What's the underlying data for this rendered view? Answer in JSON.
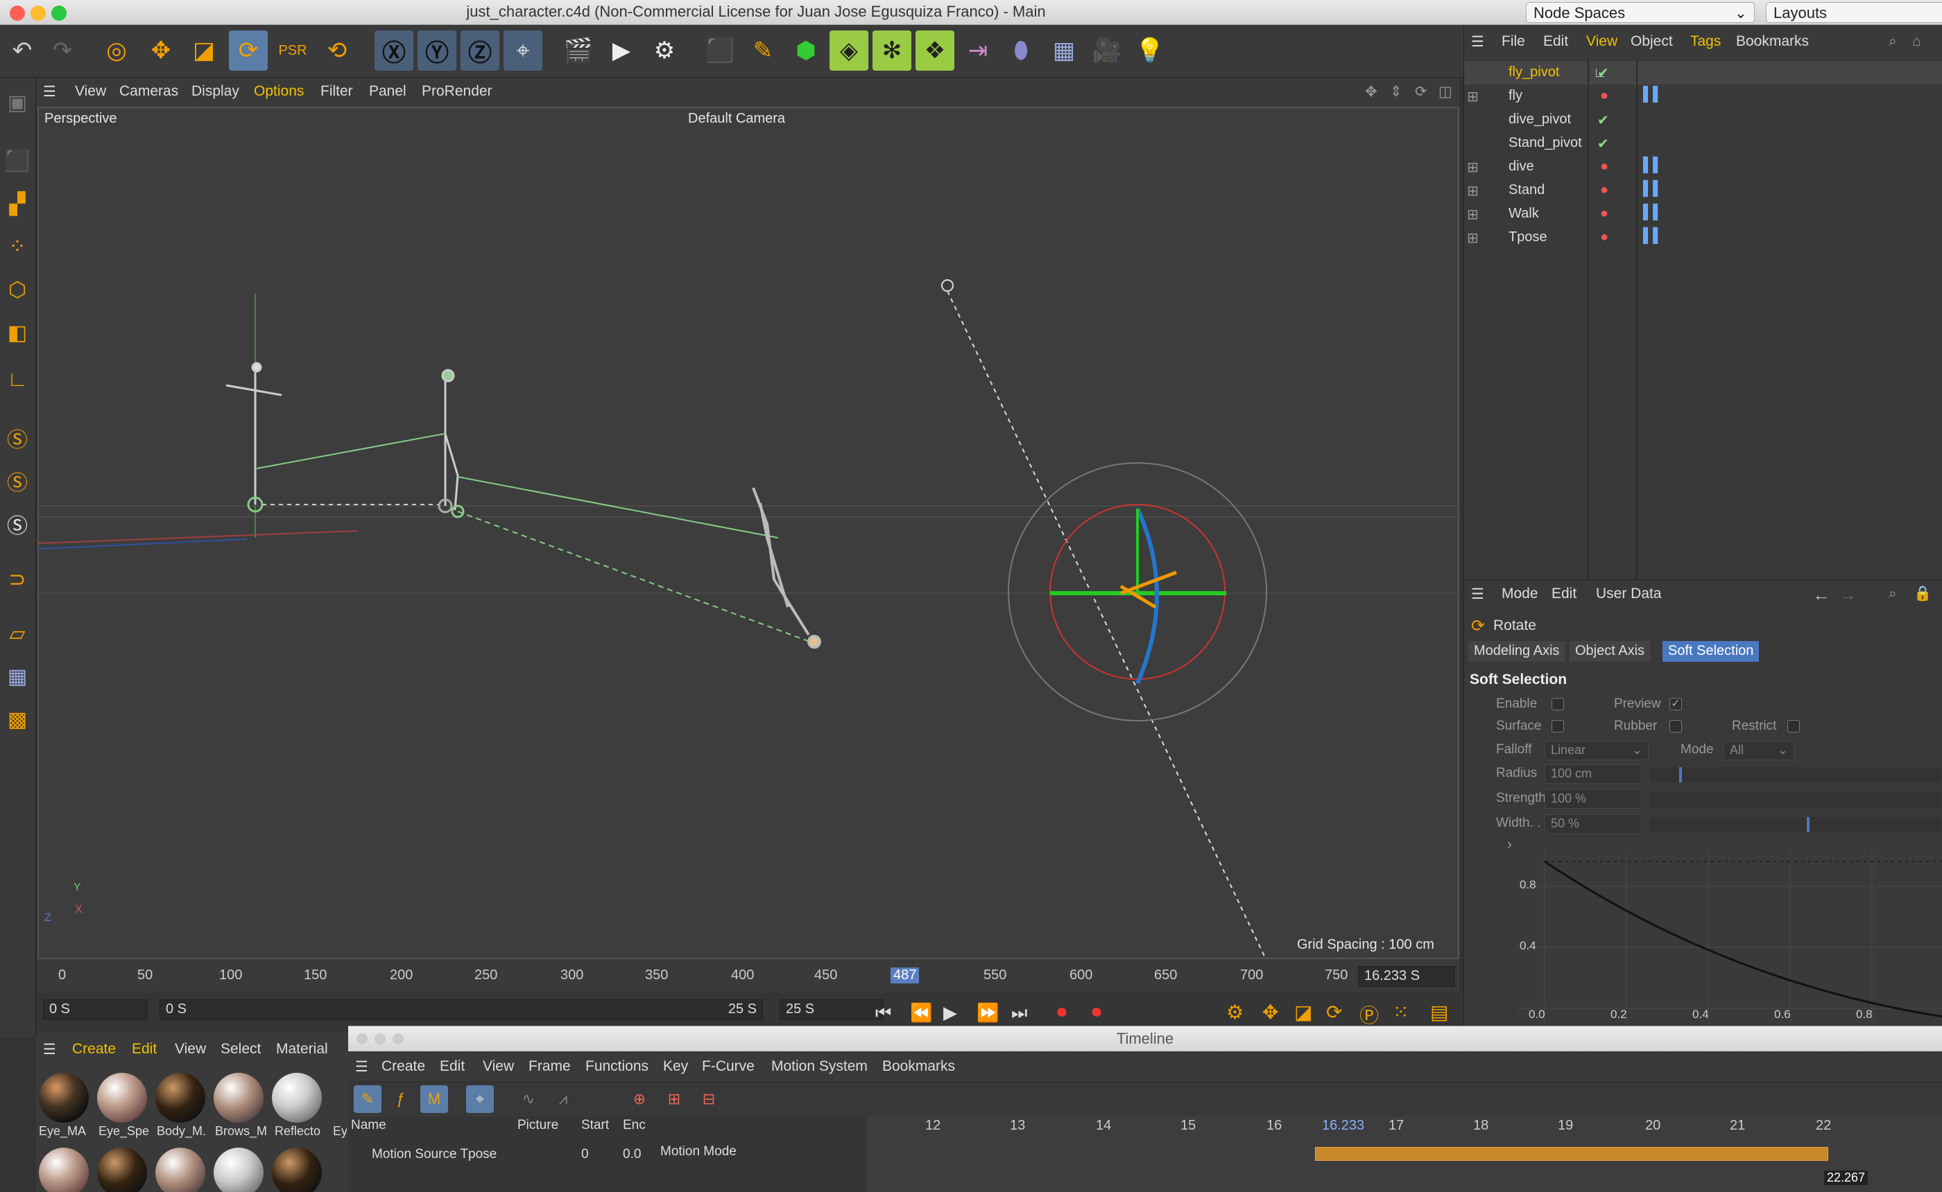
{
  "window": {
    "title": "just_character.c4d (Non-Commercial License for Juan Jose  Egusquiza Franco) - Main",
    "node_spaces": "Node Spaces",
    "layouts": "Layouts"
  },
  "viewport_menu": [
    "View",
    "Cameras",
    "Display",
    "Options",
    "Filter",
    "Panel",
    "ProRender"
  ],
  "viewport": {
    "projection": "Perspective",
    "camera": "Default Camera",
    "grid": "Grid Spacing : 100 cm",
    "axis_y": "Y",
    "axis_z": "Z",
    "axis_x": "X"
  },
  "ruler_ticks": [
    "0",
    "50",
    "100",
    "150",
    "200",
    "250",
    "300",
    "350",
    "400",
    "450",
    "487",
    "550",
    "600",
    "650",
    "700",
    "750"
  ],
  "time": {
    "current": "16.233 S",
    "start": "0 S",
    "preview_start": "0 S",
    "preview_end": "25 S",
    "end": "25 S"
  },
  "materials": {
    "menu": [
      "Create",
      "Edit",
      "View",
      "Select",
      "Material"
    ],
    "items": [
      "Eye_MA",
      "Eye_Spe",
      "Body_M.",
      "Brows_M",
      "Reflecto",
      "Ey"
    ]
  },
  "timeline": {
    "title": "Timeline",
    "menu": [
      "Create",
      "Edit",
      "View",
      "Frame",
      "Functions",
      "Key",
      "F-Curve",
      "Motion System",
      "Bookmarks"
    ],
    "cols": [
      "Name",
      "Picture",
      "Start",
      "Enc"
    ],
    "row_name": "Motion Source Tpose",
    "row_start": "0",
    "row_end": "0.0",
    "mode": "Motion Mode",
    "frames": [
      "12",
      "13",
      "14",
      "15",
      "16",
      "16.233",
      "17",
      "18",
      "19",
      "20",
      "21",
      "22"
    ],
    "end_value": "22.267"
  },
  "objects": {
    "menu": [
      "File",
      "Edit",
      "View",
      "Object",
      "Tags",
      "Bookmarks"
    ],
    "items": [
      "fly_pivot",
      "fly",
      "dive_pivot",
      "Stand_pivot",
      "dive",
      "Stand",
      "Walk",
      "Tpose"
    ]
  },
  "attributes": {
    "menu": [
      "Mode",
      "Edit",
      "User Data"
    ],
    "tool": "Rotate",
    "tabs": [
      "Modeling Axis",
      "Object Axis",
      "Soft Selection"
    ],
    "section": "Soft Selection",
    "enable": "Enable",
    "preview": "Preview",
    "surface": "Surface",
    "rubber": "Rubber",
    "restrict": "Restrict",
    "falloff": "Falloff",
    "falloff_val": "Linear",
    "mode": "Mode",
    "mode_val": "All",
    "radius": "Radius",
    "radius_val": "100 cm",
    "strength": "Strength",
    "strength_val": "100 %",
    "width": "Width. .",
    "width_val": "50 %",
    "graph_y": [
      "0.8",
      "0.4"
    ],
    "graph_x": [
      "0.0",
      "0.2",
      "0.4",
      "0.6",
      "0.8"
    ]
  }
}
